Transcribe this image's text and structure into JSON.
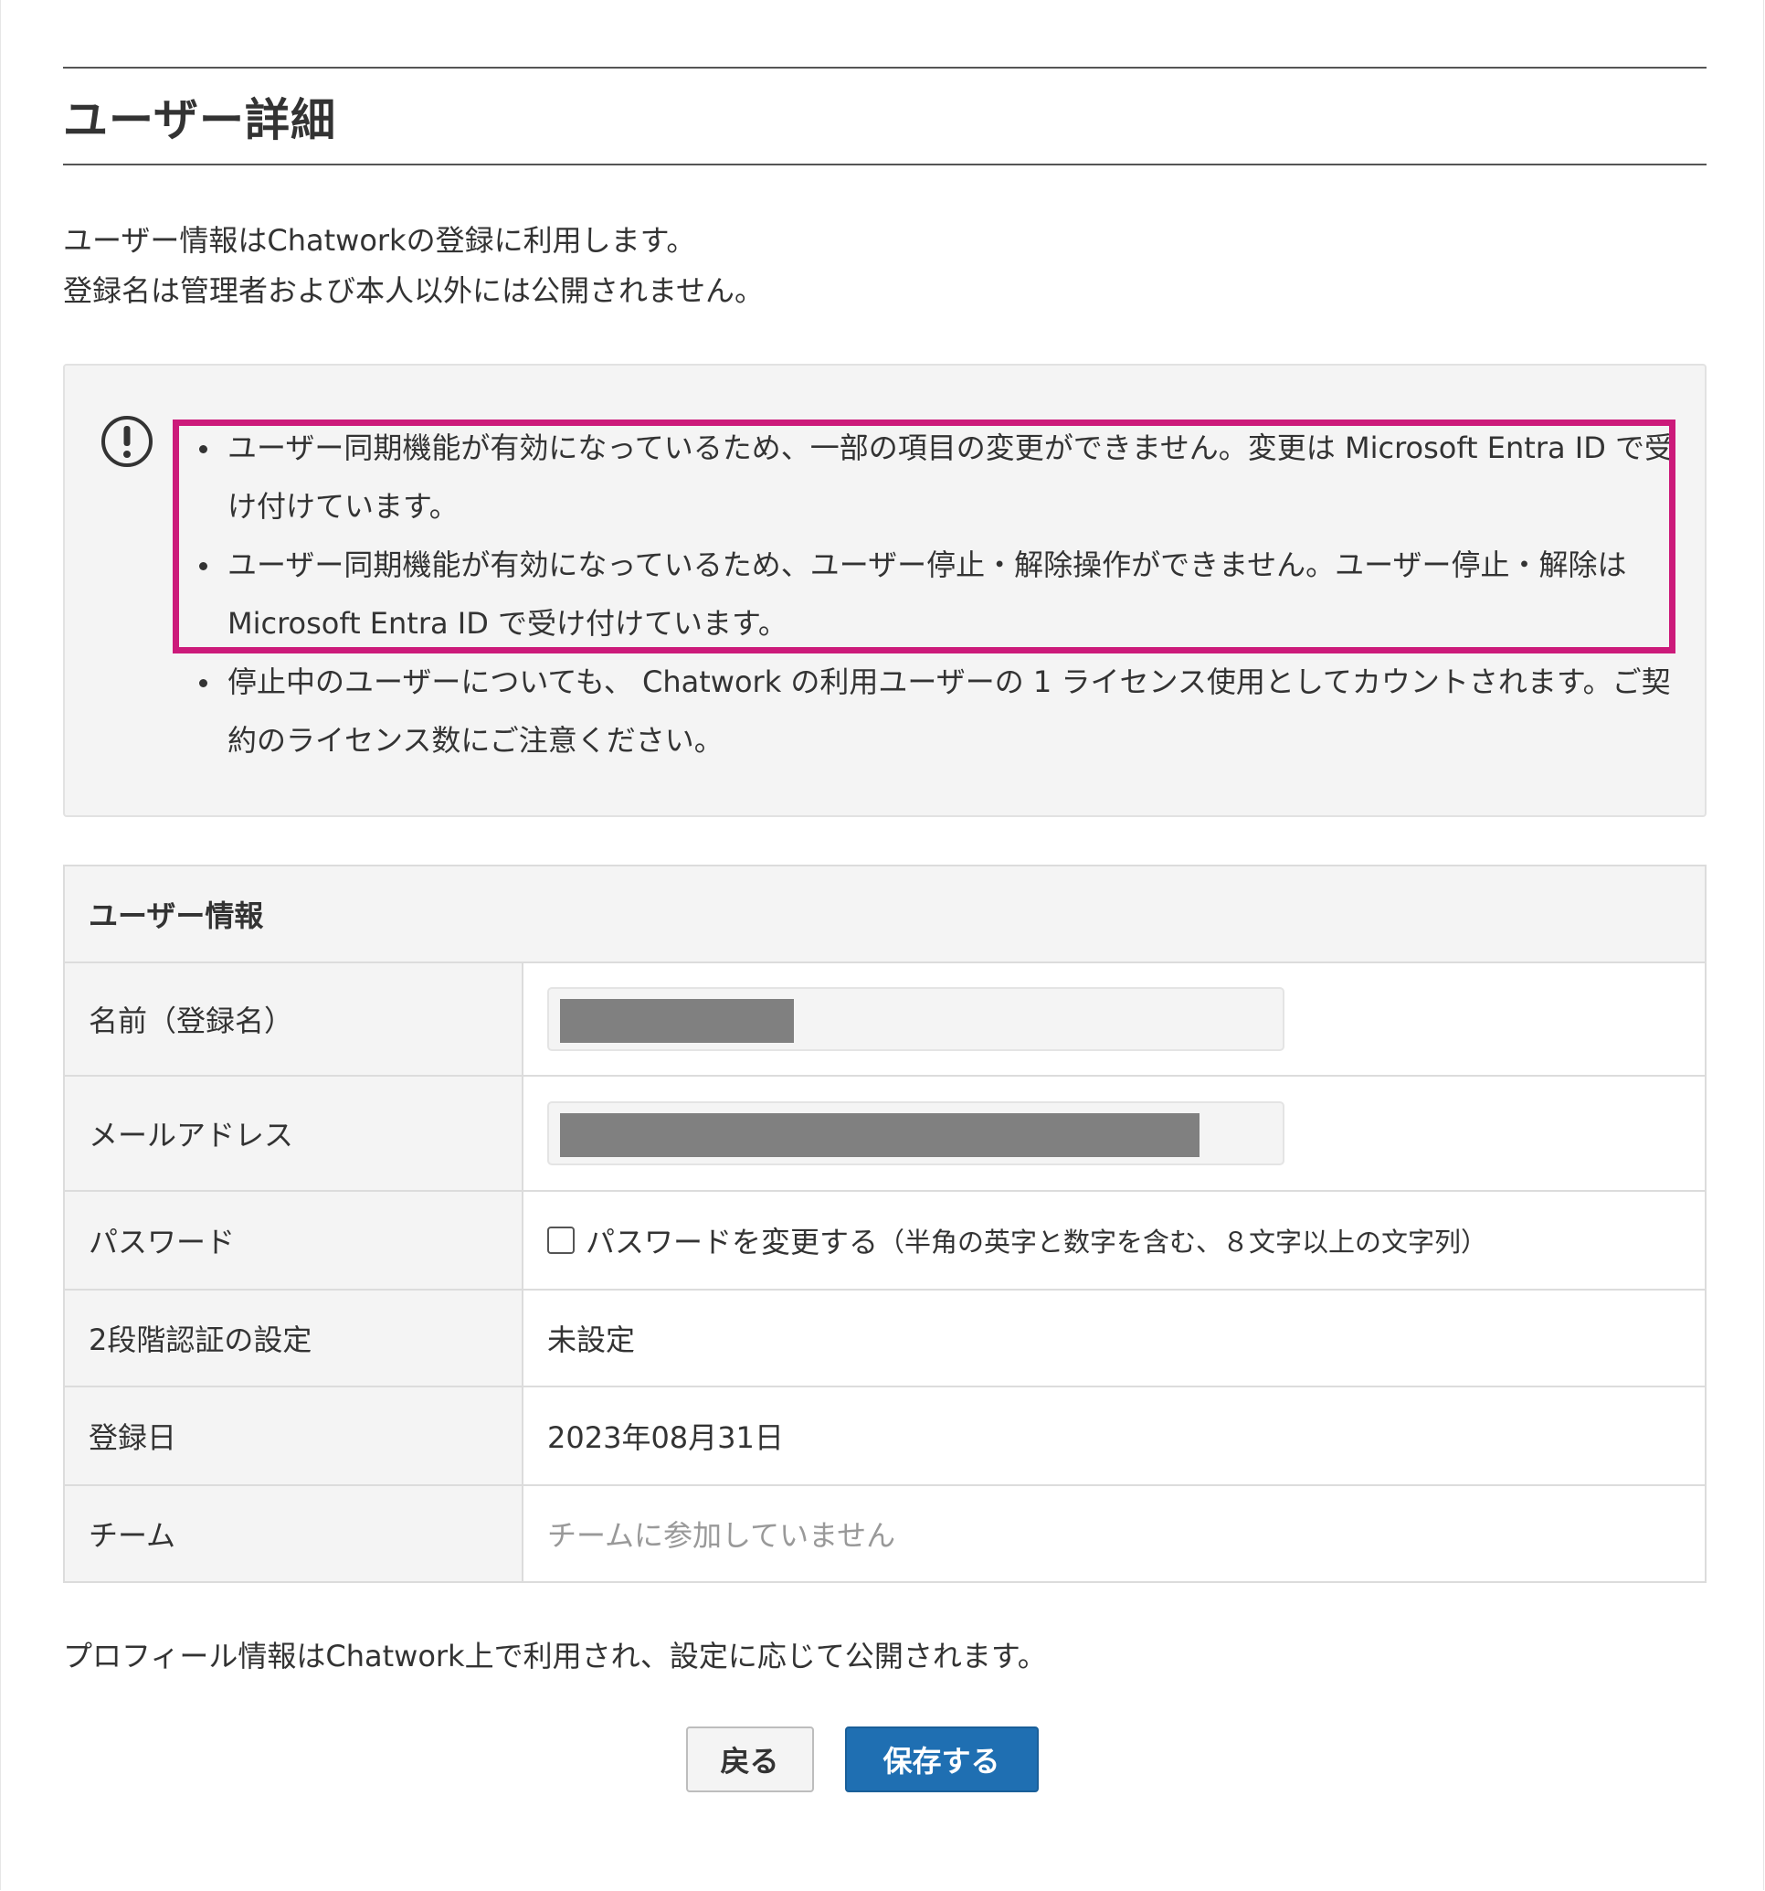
{
  "page": {
    "title": "ユーザー詳細",
    "intro_lines": [
      "ユーザー情報はChatworkの登録に利用します。",
      "登録名は管理者および本人以外には公開されません。"
    ]
  },
  "notice": {
    "icon": "exclamation-circle-icon",
    "items": [
      "ユーザー同期機能が有効になっているため、一部の項目の変更ができません。変更は Microsoft Entra ID で受け付けています。",
      "ユーザー同期機能が有効になっているため、ユーザー停止・解除操作ができません。ユーザー停止・解除は Microsoft Entra ID で受け付けています。",
      "停止中のユーザーについても、 Chatwork の利用ユーザーの 1 ライセンス使用としてカウントされます。ご契約のライセンス数にご注意ください。"
    ],
    "highlight_color": "#cc1a7a"
  },
  "user_info": {
    "heading": "ユーザー情報",
    "rows": {
      "name": {
        "label": "名前（登録名）"
      },
      "email": {
        "label": "メールアドレス"
      },
      "password": {
        "label": "パスワード",
        "checkbox_label": "パスワードを変更する",
        "checkbox_note": "（半角の英字と数字を含む、８文字以上の文字列）",
        "checked": false
      },
      "two_factor": {
        "label": "2段階認証の設定",
        "value": "未設定"
      },
      "registered": {
        "label": "登録日",
        "value": "2023年08月31日"
      },
      "team": {
        "label": "チーム",
        "value": "チームに参加していません"
      }
    }
  },
  "profile_note": "プロフィール情報はChatwork上で利用され、設定に応じて公開されます。",
  "actions": {
    "back_label": "戻る",
    "save_label": "保存する"
  },
  "colors": {
    "primary": "#1f6fb2",
    "highlight": "#cc1a7a",
    "panel_bg": "#f4f4f4",
    "muted_text": "#999999"
  }
}
